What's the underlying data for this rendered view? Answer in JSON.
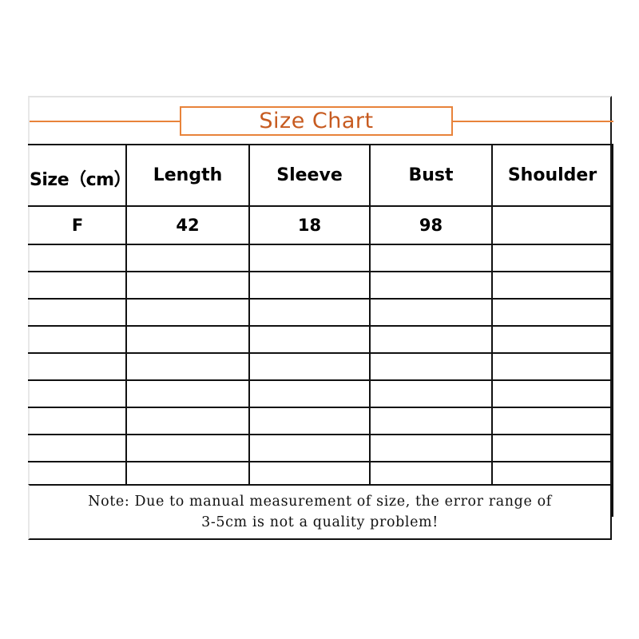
{
  "card": {
    "title": "Size Chart"
  },
  "table": {
    "headers": [
      "Size（cm）",
      "Length",
      "Sleeve",
      "Bust",
      "Shoulder"
    ],
    "rows": [
      {
        "size": "F",
        "length": "42",
        "sleeve": "18",
        "bust": "98",
        "shoulder": ""
      }
    ],
    "empty_row_count": 10
  },
  "note": {
    "text": "Note: Due to manual measurement of size, the error range of\n3-5cm is not a quality problem!"
  },
  "colors": {
    "title_text": "#c75b20",
    "title_border": "#e8833a",
    "rule": "#e8833a",
    "grid": "#111111",
    "frame_light": "#e8e8e8",
    "background": "#ffffff"
  }
}
